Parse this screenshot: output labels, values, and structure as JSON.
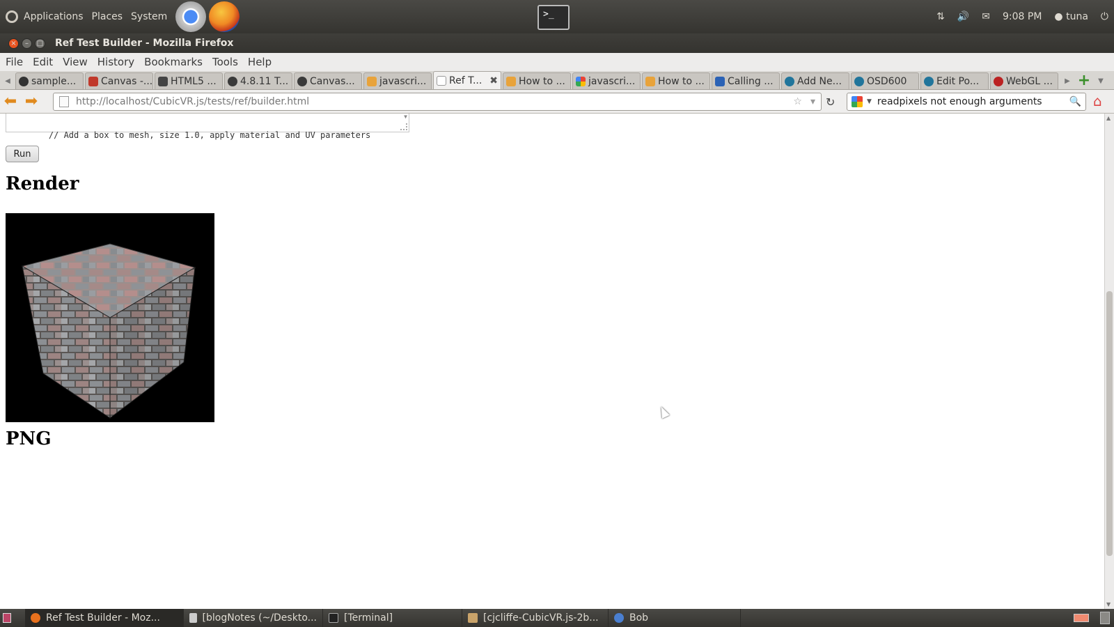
{
  "top_panel": {
    "menus": [
      "Applications",
      "Places",
      "System"
    ],
    "time": "9:08 PM",
    "user": "tuna"
  },
  "window": {
    "title": "Ref Test Builder - Mozilla Firefox"
  },
  "menubar": [
    "File",
    "Edit",
    "View",
    "History",
    "Bookmarks",
    "Tools",
    "Help"
  ],
  "tabs": [
    {
      "label": "sample...",
      "icon": "github-icon"
    },
    {
      "label": "Canvas -...",
      "icon": "bug-icon"
    },
    {
      "label": "HTML5 ...",
      "icon": "grid-icon"
    },
    {
      "label": "4.8.11 T...",
      "icon": "question-icon"
    },
    {
      "label": "Canvas...",
      "icon": "question-icon"
    },
    {
      "label": "javascri...",
      "icon": "stackoverflow-icon"
    },
    {
      "label": "Ref T...",
      "icon": "page-icon",
      "active": true
    },
    {
      "label": "How to ...",
      "icon": "stackoverflow-icon"
    },
    {
      "label": "javascri...",
      "icon": "google-icon"
    },
    {
      "label": "How to ...",
      "icon": "stackoverflow-icon"
    },
    {
      "label": "Calling ...",
      "icon": "vp-icon"
    },
    {
      "label": "Add Ne...",
      "icon": "wordpress-icon"
    },
    {
      "label": "OSD600",
      "icon": "wordpress-icon"
    },
    {
      "label": "Edit Po...",
      "icon": "wordpress-icon"
    },
    {
      "label": "WebGL ...",
      "icon": "webgl-icon"
    }
  ],
  "navbar": {
    "url_host": "http://localhost",
    "url_path": "/CubicVR.js/tests/ref/builder.html",
    "search_value": "readpixels not enough arguments"
  },
  "page": {
    "code_line": "// Add a box to mesh, size 1.0, apply material and UV parameters",
    "run_label": "Run",
    "render_heading": "Render",
    "png_heading": "PNG"
  },
  "taskbar": [
    {
      "label": "Ref Test Builder - Moz...",
      "icon": "firefox-icon",
      "active": true
    },
    {
      "label": "[blogNotes (~/Deskto...",
      "icon": "editor-icon"
    },
    {
      "label": "[Terminal]",
      "icon": "terminal-icon"
    },
    {
      "label": "[cjcliffe-CubicVR.js-2b...",
      "icon": "folder-icon"
    },
    {
      "label": "Bob",
      "icon": "chat-icon"
    }
  ]
}
